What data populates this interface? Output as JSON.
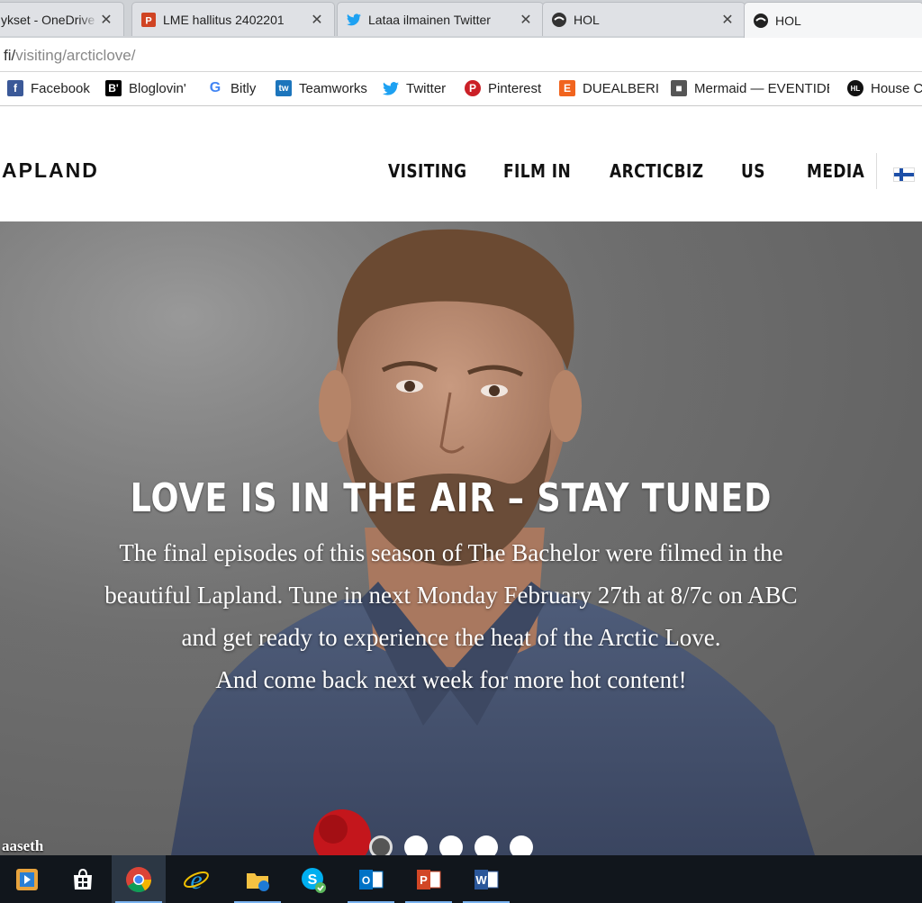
{
  "browser": {
    "tabs": [
      {
        "title": "ykset - OneDrive",
        "icon": "onedrive-icon"
      },
      {
        "title": "LME hallitus 2402201",
        "icon": "powerpoint-icon"
      },
      {
        "title": "Lataa ilmainen Twitter",
        "icon": "twitter-icon"
      },
      {
        "title": "HOL",
        "icon": "hol-icon"
      },
      {
        "title": "HOL",
        "icon": "hol-icon",
        "active": true
      }
    ],
    "url_prefix": "fi/",
    "url_path": "visiting/arcticlove/",
    "bookmarks": [
      {
        "label": "Facebook",
        "icon": "facebook-icon"
      },
      {
        "label": "Bloglovin'",
        "icon": "bloglovin-icon"
      },
      {
        "label": "Bitly",
        "icon": "google-icon"
      },
      {
        "label": "Teamworks",
        "icon": "teamworks-icon"
      },
      {
        "label": "Twitter",
        "icon": "twitter-icon"
      },
      {
        "label": "Pinterest",
        "icon": "pinterest-icon"
      },
      {
        "label": "DUEALBERI",
        "icon": "etsy-icon"
      },
      {
        "label": "Mermaid — EVENTIDE",
        "icon": "cube-icon"
      },
      {
        "label": "House C",
        "icon": "hl-icon"
      }
    ]
  },
  "site": {
    "logo": "APLAND",
    "nav": [
      "VISITING",
      "FILM IN",
      "ARCTICBIZ",
      "US",
      "MEDIA"
    ],
    "language_flag": "finland-flag-icon"
  },
  "hero": {
    "title": "LOVE IS IN THE AIR – STAY TUNED",
    "lines": [
      "The final episodes of this season of The Bachelor were filmed in the",
      "beautiful Lapland. Tune in next Monday February 27th at 8/7c on ABC",
      "and get ready to experience the heat of the Arctic Love.",
      "And come back next week for more hot content!"
    ],
    "credit": "aaseth",
    "slides": 5,
    "active_slide": 1
  },
  "taskbar": {
    "apps": [
      "media-player-icon",
      "store-icon",
      "chrome-icon",
      "internet-explorer-icon",
      "file-explorer-icon",
      "skype-icon",
      "outlook-icon",
      "powerpoint-icon",
      "word-icon"
    ],
    "active_app": "chrome-icon"
  },
  "colors": {
    "accent_blue": "#1d4fa8",
    "taskbar": "#11161c",
    "chrome_tabs": "#cfd2d6"
  }
}
